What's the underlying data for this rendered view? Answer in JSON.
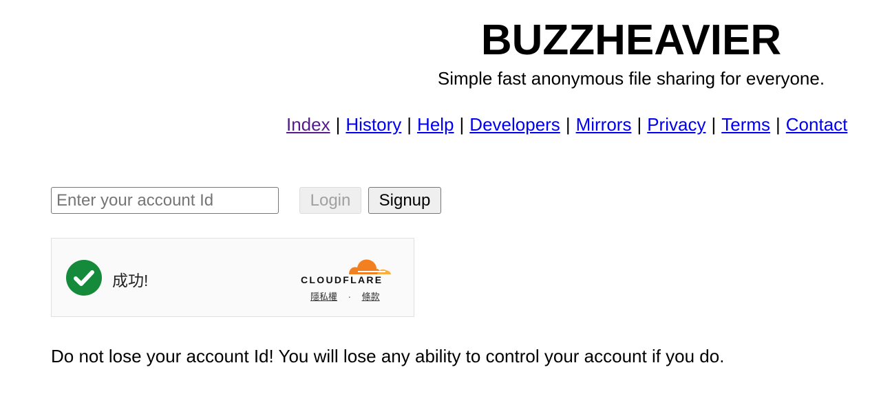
{
  "header": {
    "title": "BUZZHEAVIER",
    "subtitle": "Simple fast anonymous file sharing for everyone."
  },
  "nav": {
    "items": [
      {
        "label": "Index",
        "visited": true
      },
      {
        "label": "History"
      },
      {
        "label": "Help"
      },
      {
        "label": "Developers"
      },
      {
        "label": "Mirrors"
      },
      {
        "label": "Privacy"
      },
      {
        "label": "Terms"
      },
      {
        "label": "Contact"
      }
    ],
    "separator": "|"
  },
  "login_form": {
    "account_placeholder": "Enter your account Id",
    "account_value": "",
    "login_label": "Login",
    "signup_label": "Signup"
  },
  "captcha": {
    "status_text": "成功!",
    "brand": "CLOUDFLARE",
    "privacy_label": "隱私權",
    "dot": "·",
    "terms_label": "條款",
    "colors": {
      "check": "#148a3a",
      "cloud_main": "#f38020",
      "cloud_light": "#faae40"
    }
  },
  "warning": "Do not lose your account Id! You will lose any ability to control your account if you do."
}
